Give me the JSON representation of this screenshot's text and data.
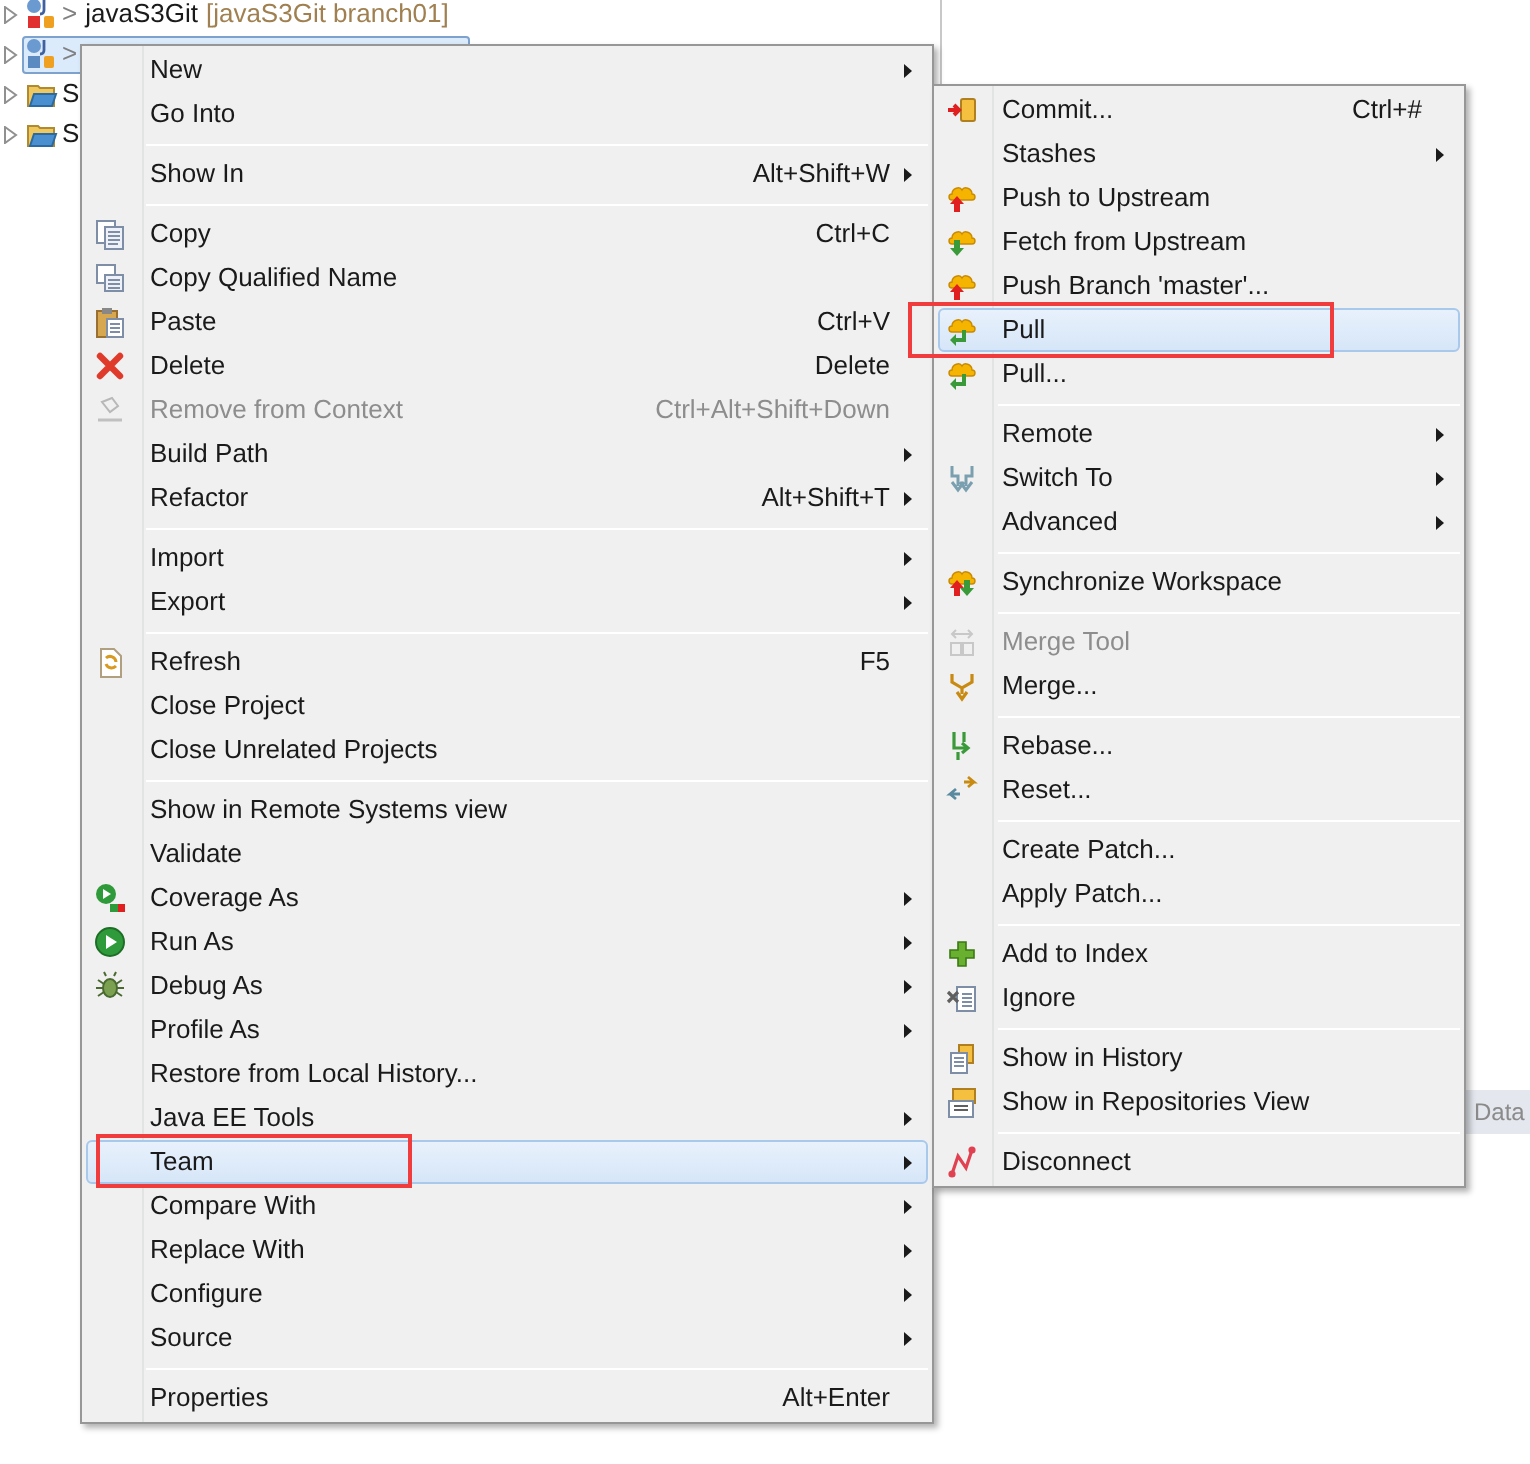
{
  "tree": {
    "items": [
      {
        "prefix": ">",
        "label": "javaS3Git",
        "decoration": "[javaS3Git branch01]",
        "selected": false,
        "kind": "project"
      },
      {
        "prefix": ">",
        "selected": true,
        "kind": "project"
      },
      {
        "label": "S",
        "selected": false,
        "kind": "folder"
      },
      {
        "label": "S",
        "selected": false,
        "kind": "folder"
      }
    ]
  },
  "context_menu": {
    "groups": [
      [
        {
          "label": "New",
          "submenu": true,
          "disabled": false,
          "selected": false,
          "marked": false
        },
        {
          "label": "Go Into",
          "submenu": false,
          "disabled": false,
          "selected": false,
          "marked": false
        }
      ],
      [
        {
          "label": "Show In",
          "shortcut": "Alt+Shift+W",
          "submenu": true,
          "disabled": false,
          "selected": false,
          "marked": false
        }
      ],
      [
        {
          "label": "Copy",
          "shortcut": "Ctrl+C",
          "submenu": false,
          "disabled": false,
          "selected": false,
          "marked": false
        },
        {
          "label": "Copy Qualified Name",
          "submenu": false,
          "disabled": false,
          "selected": false,
          "marked": false
        },
        {
          "label": "Paste",
          "shortcut": "Ctrl+V",
          "submenu": false,
          "disabled": false,
          "selected": false,
          "marked": false
        },
        {
          "label": "Delete",
          "shortcut": "Delete",
          "submenu": false,
          "disabled": false,
          "selected": false,
          "marked": false
        },
        {
          "label": "Remove from Context",
          "shortcut": "Ctrl+Alt+Shift+Down",
          "submenu": false,
          "disabled": true,
          "selected": false,
          "marked": false
        },
        {
          "label": "Build Path",
          "submenu": true,
          "disabled": false,
          "selected": false,
          "marked": false
        },
        {
          "label": "Refactor",
          "shortcut": "Alt+Shift+T",
          "submenu": true,
          "disabled": false,
          "selected": false,
          "marked": false
        }
      ],
      [
        {
          "label": "Import",
          "submenu": true,
          "disabled": false,
          "selected": false,
          "marked": false
        },
        {
          "label": "Export",
          "submenu": true,
          "disabled": false,
          "selected": false,
          "marked": false
        }
      ],
      [
        {
          "label": "Refresh",
          "shortcut": "F5",
          "submenu": false,
          "disabled": false,
          "selected": false,
          "marked": false
        },
        {
          "label": "Close Project",
          "submenu": false,
          "disabled": false,
          "selected": false,
          "marked": false
        },
        {
          "label": "Close Unrelated Projects",
          "submenu": false,
          "disabled": false,
          "selected": false,
          "marked": false
        }
      ],
      [
        {
          "label": "Show in Remote Systems view",
          "submenu": false,
          "disabled": false,
          "selected": false,
          "marked": false
        },
        {
          "label": "Validate",
          "submenu": false,
          "disabled": false,
          "selected": false,
          "marked": false
        },
        {
          "label": "Coverage As",
          "submenu": true,
          "disabled": false,
          "selected": false,
          "marked": false
        },
        {
          "label": "Run As",
          "submenu": true,
          "disabled": false,
          "selected": false,
          "marked": false
        },
        {
          "label": "Debug As",
          "submenu": true,
          "disabled": false,
          "selected": false,
          "marked": false
        },
        {
          "label": "Profile As",
          "submenu": true,
          "disabled": false,
          "selected": false,
          "marked": false
        },
        {
          "label": "Restore from Local History...",
          "submenu": false,
          "disabled": false,
          "selected": false,
          "marked": false
        },
        {
          "label": "Java EE Tools",
          "submenu": true,
          "disabled": false,
          "selected": false,
          "marked": false
        },
        {
          "label": "Team",
          "submenu": true,
          "disabled": false,
          "selected": true,
          "marked": true
        },
        {
          "label": "Compare With",
          "submenu": true,
          "disabled": false,
          "selected": false,
          "marked": false
        },
        {
          "label": "Replace With",
          "submenu": true,
          "disabled": false,
          "selected": false,
          "marked": false
        },
        {
          "label": "Configure",
          "submenu": true,
          "disabled": false,
          "selected": false,
          "marked": false
        },
        {
          "label": "Source",
          "submenu": true,
          "disabled": false,
          "selected": false,
          "marked": false
        }
      ],
      [
        {
          "label": "Properties",
          "shortcut": "Alt+Enter",
          "submenu": false,
          "disabled": false,
          "selected": false,
          "marked": false
        }
      ]
    ]
  },
  "team_submenu": {
    "groups": [
      [
        {
          "label": "Commit...",
          "shortcut": "Ctrl+#",
          "submenu": false,
          "disabled": false,
          "selected": false,
          "marked": false
        },
        {
          "label": "Stashes",
          "submenu": true,
          "disabled": false,
          "selected": false,
          "marked": false
        },
        {
          "label": "Push to Upstream",
          "submenu": false,
          "disabled": false,
          "selected": false,
          "marked": false
        },
        {
          "label": "Fetch from Upstream",
          "submenu": false,
          "disabled": false,
          "selected": false,
          "marked": false
        },
        {
          "label": "Push Branch 'master'...",
          "submenu": false,
          "disabled": false,
          "selected": false,
          "marked": false
        },
        {
          "label": "Pull",
          "submenu": false,
          "disabled": false,
          "selected": true,
          "marked": true
        },
        {
          "label": "Pull...",
          "submenu": false,
          "disabled": false,
          "selected": false,
          "marked": false
        }
      ],
      [
        {
          "label": "Remote",
          "submenu": true,
          "disabled": false,
          "selected": false,
          "marked": false
        },
        {
          "label": "Switch To",
          "submenu": true,
          "disabled": false,
          "selected": false,
          "marked": false
        },
        {
          "label": "Advanced",
          "submenu": true,
          "disabled": false,
          "selected": false,
          "marked": false
        }
      ],
      [
        {
          "label": "Synchronize Workspace",
          "submenu": false,
          "disabled": false,
          "selected": false,
          "marked": false
        }
      ],
      [
        {
          "label": "Merge Tool",
          "submenu": false,
          "disabled": true,
          "selected": false,
          "marked": false
        },
        {
          "label": "Merge...",
          "submenu": false,
          "disabled": false,
          "selected": false,
          "marked": false
        }
      ],
      [
        {
          "label": "Rebase...",
          "submenu": false,
          "disabled": false,
          "selected": false,
          "marked": false
        },
        {
          "label": "Reset...",
          "submenu": false,
          "disabled": false,
          "selected": false,
          "marked": false
        }
      ],
      [
        {
          "label": "Create Patch...",
          "submenu": false,
          "disabled": false,
          "selected": false,
          "marked": false
        },
        {
          "label": "Apply Patch...",
          "submenu": false,
          "disabled": false,
          "selected": false,
          "marked": false
        }
      ],
      [
        {
          "label": "Add to Index",
          "submenu": false,
          "disabled": false,
          "selected": false,
          "marked": false
        },
        {
          "label": "Ignore",
          "submenu": false,
          "disabled": false,
          "selected": false,
          "marked": false
        }
      ],
      [
        {
          "label": "Show in History",
          "submenu": false,
          "disabled": false,
          "selected": false,
          "marked": false
        },
        {
          "label": "Show in Repositories View",
          "submenu": false,
          "disabled": false,
          "selected": false,
          "marked": false
        }
      ],
      [
        {
          "label": "Disconnect",
          "submenu": false,
          "disabled": false,
          "selected": false,
          "marked": false
        }
      ]
    ]
  },
  "background_tab": {
    "label": "Data"
  }
}
